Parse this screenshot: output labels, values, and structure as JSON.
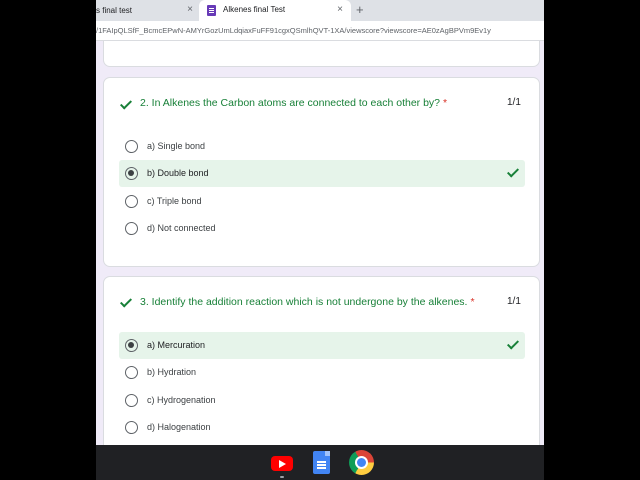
{
  "browser": {
    "tabs": [
      {
        "title": "s final test",
        "close": "×"
      },
      {
        "title": "Alkenes final Test",
        "close": "×"
      }
    ],
    "new_tab": "+",
    "url": "/1FAIpQLSfF_BcmcEPwN-AMYrGozUmLdqiaxFuFF91cgxQSmlhQVT-1XA/viewscore?viewscore=AE0zAgBPVm9Ev1y"
  },
  "colors": {
    "correct_green": "#188038",
    "correct_bg": "#e6f4ea",
    "required_red": "#d93025",
    "form_bg": "#f0ebf8"
  },
  "questions": [
    {
      "title": "2. In Alkenes the Carbon atoms are connected to each other by?",
      "required": "*",
      "score": "1/1",
      "options": [
        {
          "label": "a) Single bond",
          "selected": false,
          "correct": false
        },
        {
          "label": "b) Double bond",
          "selected": true,
          "correct": true
        },
        {
          "label": "c) Triple bond",
          "selected": false,
          "correct": false
        },
        {
          "label": "d) Not connected",
          "selected": false,
          "correct": false
        }
      ]
    },
    {
      "title": "3. Identify the addition reaction which is not undergone by the alkenes.",
      "required": "*",
      "score": "1/1",
      "options": [
        {
          "label": "a) Mercuration",
          "selected": true,
          "correct": true
        },
        {
          "label": "b) Hydration",
          "selected": false,
          "correct": false
        },
        {
          "label": "c) Hydrogenation",
          "selected": false,
          "correct": false
        },
        {
          "label": "d) Halogenation",
          "selected": false,
          "correct": false
        }
      ]
    }
  ],
  "taskbar": {
    "apps": [
      "youtube-icon",
      "google-docs-icon",
      "chrome-icon"
    ]
  }
}
